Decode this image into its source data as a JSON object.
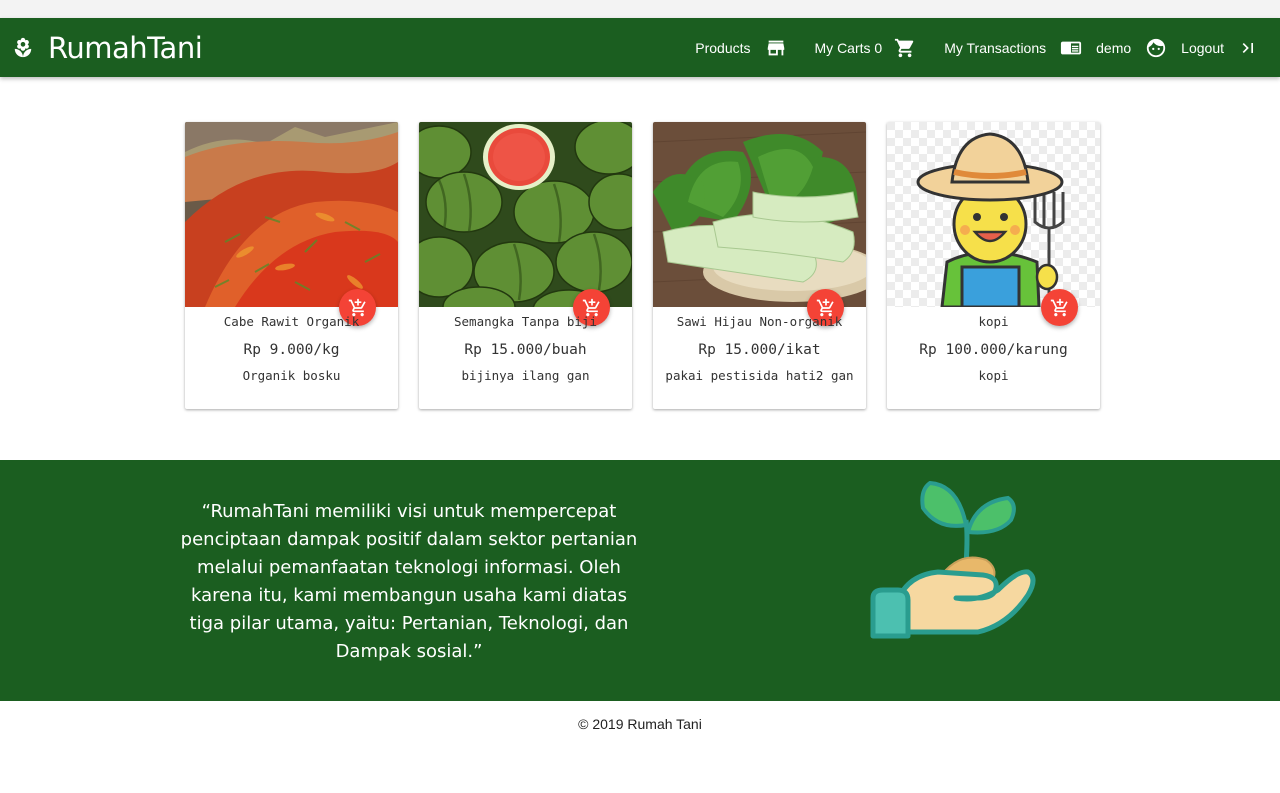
{
  "navbar": {
    "brand": "RumahTani",
    "items": [
      {
        "label": "Products",
        "icon": "store-icon"
      },
      {
        "label": "My Carts 0",
        "icon": "cart-icon"
      },
      {
        "label": "My Transactions",
        "icon": "receipt-icon"
      },
      {
        "label": "demo",
        "icon": "face-icon"
      },
      {
        "label": "Logout",
        "icon": "logout-icon"
      }
    ]
  },
  "products": [
    {
      "title": "Cabe Rawit Organik",
      "price": "Rp 9.000/kg",
      "description": "Organik bosku"
    },
    {
      "title": "Semangka Tanpa biji",
      "price": "Rp 15.000/buah",
      "description": "bijinya ilang gan"
    },
    {
      "title": "Sawi Hijau Non-organik",
      "price": "Rp 15.000/ikat",
      "description": "pakai pestisida hati2 gan"
    },
    {
      "title": "kopi",
      "price": "Rp 100.000/karung",
      "description": "kopi"
    }
  ],
  "vision": {
    "quote": "“RumahTani memiliki visi untuk mempercepat penciptaan dampak positif dalam sektor pertanian melalui pemanfaatan teknologi informasi. Oleh karena itu, kami membangun usaha kami diatas tiga pilar utama, yaitu: Pertanian, Teknologi, dan Dampak sosial.”"
  },
  "footer": {
    "copyright": "© 2019 Rumah Tani"
  },
  "colors": {
    "primary": "#1b5e20",
    "accent": "#f44336",
    "text": "#333333"
  }
}
